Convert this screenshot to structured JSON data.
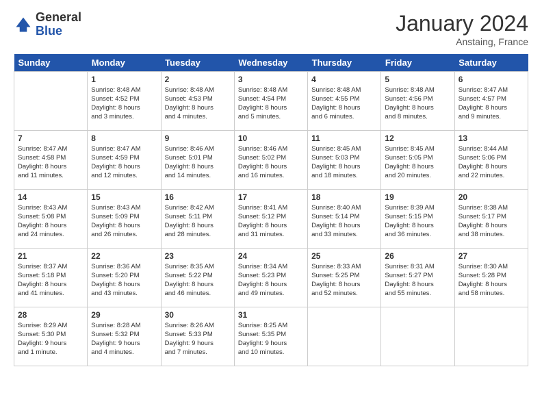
{
  "logo": {
    "general": "General",
    "blue": "Blue"
  },
  "title": "January 2024",
  "subtitle": "Anstaing, France",
  "headers": [
    "Sunday",
    "Monday",
    "Tuesday",
    "Wednesday",
    "Thursday",
    "Friday",
    "Saturday"
  ],
  "weeks": [
    [
      {
        "day": "",
        "lines": []
      },
      {
        "day": "1",
        "lines": [
          "Sunrise: 8:48 AM",
          "Sunset: 4:52 PM",
          "Daylight: 8 hours",
          "and 3 minutes."
        ]
      },
      {
        "day": "2",
        "lines": [
          "Sunrise: 8:48 AM",
          "Sunset: 4:53 PM",
          "Daylight: 8 hours",
          "and 4 minutes."
        ]
      },
      {
        "day": "3",
        "lines": [
          "Sunrise: 8:48 AM",
          "Sunset: 4:54 PM",
          "Daylight: 8 hours",
          "and 5 minutes."
        ]
      },
      {
        "day": "4",
        "lines": [
          "Sunrise: 8:48 AM",
          "Sunset: 4:55 PM",
          "Daylight: 8 hours",
          "and 6 minutes."
        ]
      },
      {
        "day": "5",
        "lines": [
          "Sunrise: 8:48 AM",
          "Sunset: 4:56 PM",
          "Daylight: 8 hours",
          "and 8 minutes."
        ]
      },
      {
        "day": "6",
        "lines": [
          "Sunrise: 8:47 AM",
          "Sunset: 4:57 PM",
          "Daylight: 8 hours",
          "and 9 minutes."
        ]
      }
    ],
    [
      {
        "day": "7",
        "lines": [
          "Sunrise: 8:47 AM",
          "Sunset: 4:58 PM",
          "Daylight: 8 hours",
          "and 11 minutes."
        ]
      },
      {
        "day": "8",
        "lines": [
          "Sunrise: 8:47 AM",
          "Sunset: 4:59 PM",
          "Daylight: 8 hours",
          "and 12 minutes."
        ]
      },
      {
        "day": "9",
        "lines": [
          "Sunrise: 8:46 AM",
          "Sunset: 5:01 PM",
          "Daylight: 8 hours",
          "and 14 minutes."
        ]
      },
      {
        "day": "10",
        "lines": [
          "Sunrise: 8:46 AM",
          "Sunset: 5:02 PM",
          "Daylight: 8 hours",
          "and 16 minutes."
        ]
      },
      {
        "day": "11",
        "lines": [
          "Sunrise: 8:45 AM",
          "Sunset: 5:03 PM",
          "Daylight: 8 hours",
          "and 18 minutes."
        ]
      },
      {
        "day": "12",
        "lines": [
          "Sunrise: 8:45 AM",
          "Sunset: 5:05 PM",
          "Daylight: 8 hours",
          "and 20 minutes."
        ]
      },
      {
        "day": "13",
        "lines": [
          "Sunrise: 8:44 AM",
          "Sunset: 5:06 PM",
          "Daylight: 8 hours",
          "and 22 minutes."
        ]
      }
    ],
    [
      {
        "day": "14",
        "lines": [
          "Sunrise: 8:43 AM",
          "Sunset: 5:08 PM",
          "Daylight: 8 hours",
          "and 24 minutes."
        ]
      },
      {
        "day": "15",
        "lines": [
          "Sunrise: 8:43 AM",
          "Sunset: 5:09 PM",
          "Daylight: 8 hours",
          "and 26 minutes."
        ]
      },
      {
        "day": "16",
        "lines": [
          "Sunrise: 8:42 AM",
          "Sunset: 5:11 PM",
          "Daylight: 8 hours",
          "and 28 minutes."
        ]
      },
      {
        "day": "17",
        "lines": [
          "Sunrise: 8:41 AM",
          "Sunset: 5:12 PM",
          "Daylight: 8 hours",
          "and 31 minutes."
        ]
      },
      {
        "day": "18",
        "lines": [
          "Sunrise: 8:40 AM",
          "Sunset: 5:14 PM",
          "Daylight: 8 hours",
          "and 33 minutes."
        ]
      },
      {
        "day": "19",
        "lines": [
          "Sunrise: 8:39 AM",
          "Sunset: 5:15 PM",
          "Daylight: 8 hours",
          "and 36 minutes."
        ]
      },
      {
        "day": "20",
        "lines": [
          "Sunrise: 8:38 AM",
          "Sunset: 5:17 PM",
          "Daylight: 8 hours",
          "and 38 minutes."
        ]
      }
    ],
    [
      {
        "day": "21",
        "lines": [
          "Sunrise: 8:37 AM",
          "Sunset: 5:18 PM",
          "Daylight: 8 hours",
          "and 41 minutes."
        ]
      },
      {
        "day": "22",
        "lines": [
          "Sunrise: 8:36 AM",
          "Sunset: 5:20 PM",
          "Daylight: 8 hours",
          "and 43 minutes."
        ]
      },
      {
        "day": "23",
        "lines": [
          "Sunrise: 8:35 AM",
          "Sunset: 5:22 PM",
          "Daylight: 8 hours",
          "and 46 minutes."
        ]
      },
      {
        "day": "24",
        "lines": [
          "Sunrise: 8:34 AM",
          "Sunset: 5:23 PM",
          "Daylight: 8 hours",
          "and 49 minutes."
        ]
      },
      {
        "day": "25",
        "lines": [
          "Sunrise: 8:33 AM",
          "Sunset: 5:25 PM",
          "Daylight: 8 hours",
          "and 52 minutes."
        ]
      },
      {
        "day": "26",
        "lines": [
          "Sunrise: 8:31 AM",
          "Sunset: 5:27 PM",
          "Daylight: 8 hours",
          "and 55 minutes."
        ]
      },
      {
        "day": "27",
        "lines": [
          "Sunrise: 8:30 AM",
          "Sunset: 5:28 PM",
          "Daylight: 8 hours",
          "and 58 minutes."
        ]
      }
    ],
    [
      {
        "day": "28",
        "lines": [
          "Sunrise: 8:29 AM",
          "Sunset: 5:30 PM",
          "Daylight: 9 hours",
          "and 1 minute."
        ]
      },
      {
        "day": "29",
        "lines": [
          "Sunrise: 8:28 AM",
          "Sunset: 5:32 PM",
          "Daylight: 9 hours",
          "and 4 minutes."
        ]
      },
      {
        "day": "30",
        "lines": [
          "Sunrise: 8:26 AM",
          "Sunset: 5:33 PM",
          "Daylight: 9 hours",
          "and 7 minutes."
        ]
      },
      {
        "day": "31",
        "lines": [
          "Sunrise: 8:25 AM",
          "Sunset: 5:35 PM",
          "Daylight: 9 hours",
          "and 10 minutes."
        ]
      },
      {
        "day": "",
        "lines": []
      },
      {
        "day": "",
        "lines": []
      },
      {
        "day": "",
        "lines": []
      }
    ]
  ]
}
